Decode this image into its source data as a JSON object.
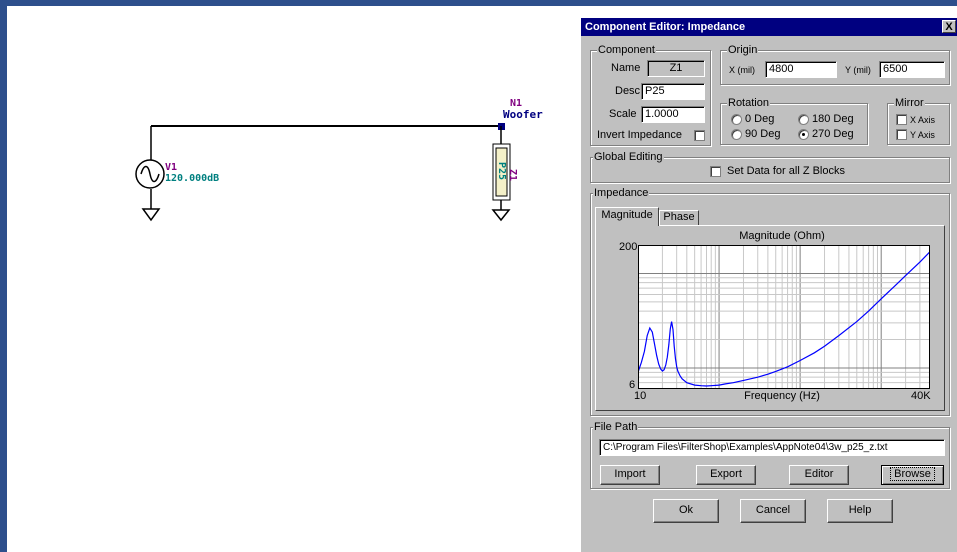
{
  "schematic": {
    "source": {
      "ref": "V1",
      "value": "120.000dB"
    },
    "node": {
      "ref": "N1",
      "name": "Woofer"
    },
    "impedance": {
      "ref": "Z1",
      "desc": "P25"
    },
    "colors": {
      "wire": "#000000",
      "ref": "#800080",
      "value": "#008080",
      "node": "#000080"
    }
  },
  "dialog": {
    "title": "Component Editor: Impedance",
    "close_label": "X",
    "component": {
      "group_label": "Component",
      "name_label": "Name",
      "name_value": "Z1",
      "desc_label": "Desc",
      "desc_value": "P25",
      "scale_label": "Scale",
      "scale_value": "1.0000",
      "invert_label": "Invert Impedance"
    },
    "origin": {
      "group_label": "Origin",
      "x_label": "X (mil)",
      "x_value": "4800",
      "y_label": "Y (mil)",
      "y_value": "6500"
    },
    "rotation": {
      "group_label": "Rotation",
      "options": [
        "0 Deg",
        "180 Deg",
        "90 Deg",
        "270 Deg"
      ],
      "selected": "270 Deg"
    },
    "mirror": {
      "group_label": "Mirror",
      "x_label": "X Axis",
      "y_label": "Y Axis"
    },
    "global": {
      "group_label": "Global Editing",
      "set_data_label": "Set Data for all Z Blocks"
    },
    "impedance": {
      "group_label": "Impedance",
      "tabs": [
        "Magnitude",
        "Phase"
      ],
      "active_tab": "Magnitude"
    },
    "file_path": {
      "group_label": "File Path",
      "value": "C:\\Program Files\\FilterShop\\Examples\\AppNote04\\3w_p25_z.txt",
      "buttons": {
        "import": "Import",
        "export": "Export",
        "editor": "Editor",
        "browse": "Browse"
      }
    },
    "buttons": {
      "ok": "Ok",
      "cancel": "Cancel",
      "help": "Help"
    }
  },
  "chart_data": {
    "type": "line",
    "title": "Magnitude (Ohm)",
    "xlabel": "Frequency (Hz)",
    "ylabel": "",
    "x_scale": "log",
    "y_scale": "log",
    "xlim": [
      10,
      40000
    ],
    "ylim": [
      6,
      200
    ],
    "x_tick_labels": [
      "10",
      "40K"
    ],
    "y_tick_labels": [
      "200",
      "6"
    ],
    "grid": true,
    "series_color": "#0000ff",
    "series": [
      {
        "x": [
          10,
          11,
          12,
          13,
          14,
          15,
          16,
          17,
          18,
          19,
          20,
          21,
          22,
          23,
          24,
          25,
          26,
          27,
          28,
          29,
          30,
          31,
          33,
          35,
          40,
          50,
          60,
          70,
          80,
          100,
          120,
          150,
          200,
          300,
          400,
          500,
          700,
          1000,
          1500,
          2000,
          3000,
          5000,
          7000,
          10000,
          15000,
          20000,
          30000,
          40000
        ],
        "y": [
          9.0,
          11.5,
          15.0,
          22.0,
          26.5,
          24.0,
          18.0,
          13.5,
          11.0,
          9.8,
          9.3,
          9.6,
          10.8,
          13.0,
          17.5,
          26.0,
          31.0,
          25.5,
          17.0,
          12.5,
          10.3,
          9.3,
          8.3,
          7.7,
          7.0,
          6.6,
          6.5,
          6.45,
          6.5,
          6.6,
          6.8,
          7.0,
          7.4,
          8.0,
          8.6,
          9.2,
          10.3,
          12.0,
          14.5,
          17.0,
          22.0,
          31.0,
          40.0,
          54.0,
          75.0,
          95.0,
          132.0,
          170.0
        ]
      }
    ]
  }
}
